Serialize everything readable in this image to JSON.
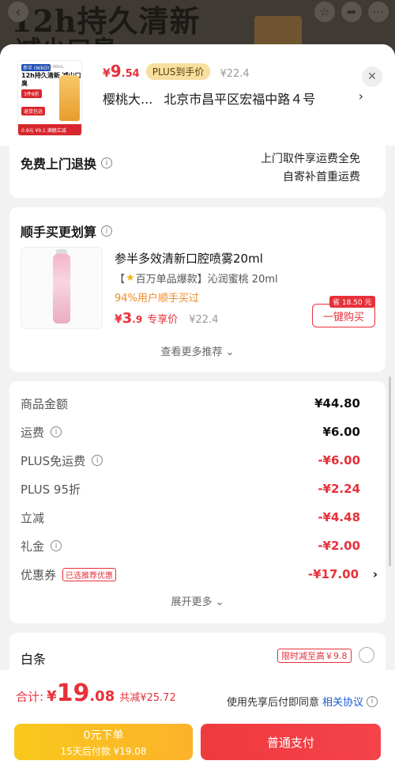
{
  "background": {
    "title": "12h持久清新",
    "subtitle": "减少口臭",
    "icons": [
      "back-icon",
      "star-icon",
      "share-icon",
      "more-icon"
    ]
  },
  "header": {
    "thumbnail": {
      "brand_tag": "参半 (NIKO)",
      "tiny_text": "5,410.00mL",
      "headline": "12h持久清新 减少口臭",
      "tag_a": "3件8折",
      "tag_b": "退货包运",
      "bar_text": "0.9元 ¥9.1  满额立减"
    },
    "price_yen": "¥",
    "price_int": "9",
    "price_dec": ".54",
    "plus_tag": "PLUS到手价",
    "orig_price": "¥22.4",
    "address_name": "樱桃大...",
    "address_detail": "北京市昌平区宏福中路４号"
  },
  "return_service": {
    "label": "免费上门退换",
    "desc_line1": "上门取件享运费全免",
    "desc_line2": "自寄补首重运费"
  },
  "recommend": {
    "title": "顺手买更划算",
    "product_name": "参半多效清新口腔喷雾20ml",
    "tag_open": "【",
    "tag_text": "百万单品爆款】沁润蜜桃 20ml",
    "ratio": "94%用户顺手买过",
    "price_yen": "¥",
    "price_int": "3",
    "price_dec": ".9",
    "price_label": "专享价",
    "orig_price": "¥22.4",
    "save_badge": "省 18.50 元",
    "buy_label": "一键购买",
    "more_label": "查看更多推荐 ⌄"
  },
  "summary": {
    "rows": [
      {
        "label": "商品金额",
        "value": "¥44.80"
      },
      {
        "label": "运费",
        "value": "¥6.00"
      },
      {
        "label": "PLUS免运费",
        "value": "-¥6.00"
      },
      {
        "label": "PLUS 95折",
        "value": "-¥2.24"
      },
      {
        "label": "立减",
        "value": "-¥4.48"
      },
      {
        "label": "礼金",
        "value": "-¥2.00"
      },
      {
        "label": "优惠券",
        "value": "-¥17.00"
      }
    ],
    "coupon_tag": "已选推荐优惠",
    "expand_label": "展开更多 ⌄"
  },
  "payment": {
    "baitiao_label": "白条",
    "baitiao_tag": "限时减至高￥9.8"
  },
  "bottom": {
    "total_label": "合计:",
    "total_yen": "¥",
    "total_int": "19",
    "total_dec": ".08",
    "saved": "共减¥25.72",
    "agree_text": "使用先享后付即同意",
    "agree_link": "相关协议",
    "later_line1": "0元下单",
    "later_line2": "15天后付款 ¥19.08",
    "normal_label": "普通支付"
  },
  "colors": {
    "accent_red": "#e8303a",
    "plus_gold": "#f7dfa0",
    "later_yellow": "#f9c81c",
    "link_blue": "#1a5bd4"
  }
}
